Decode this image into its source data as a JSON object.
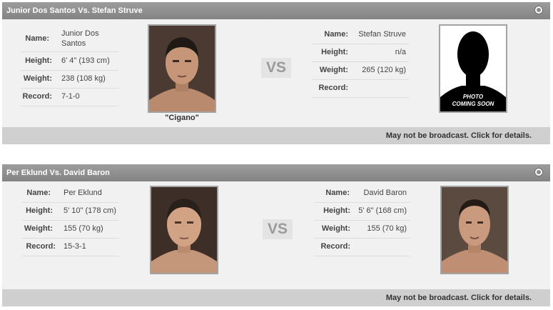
{
  "bouts": [
    {
      "title": "Junior Dos Santos Vs. Stefan Struve",
      "vs": "VS",
      "footer": "May not be broadcast. Click for details.",
      "fighter1": {
        "name_label": "Name:",
        "name": "Junior Dos Santos",
        "height_label": "Height:",
        "height": "6' 4\" (193 cm)",
        "weight_label": "Weight:",
        "weight": "238 (108 kg)",
        "record_label": "Record:",
        "record": "7-1-0",
        "nickname": "\"Cigano\""
      },
      "fighter2": {
        "name_label": "Name:",
        "name": "Stefan Struve",
        "height_label": "Height:",
        "height": "n/a",
        "weight_label": "Weight:",
        "weight": "265 (120 kg)",
        "record_label": "Record:",
        "record": "",
        "placeholder_line1": "PHOTO",
        "placeholder_line2": "COMING SOON"
      }
    },
    {
      "title": "Per Eklund Vs. David Baron",
      "vs": "VS",
      "footer": "May not be broadcast. Click for details.",
      "fighter1": {
        "name_label": "Name:",
        "name": "Per Eklund",
        "height_label": "Height:",
        "height": "5' 10\" (178 cm)",
        "weight_label": "Weight:",
        "weight": "155 (70 kg)",
        "record_label": "Record:",
        "record": "15-3-1"
      },
      "fighter2": {
        "name_label": "Name:",
        "name": "David Baron",
        "height_label": "Height:",
        "height": "5' 6\" (168 cm)",
        "weight_label": "Weight:",
        "weight": "155 (70 kg)",
        "record_label": "Record:",
        "record": ""
      }
    }
  ]
}
